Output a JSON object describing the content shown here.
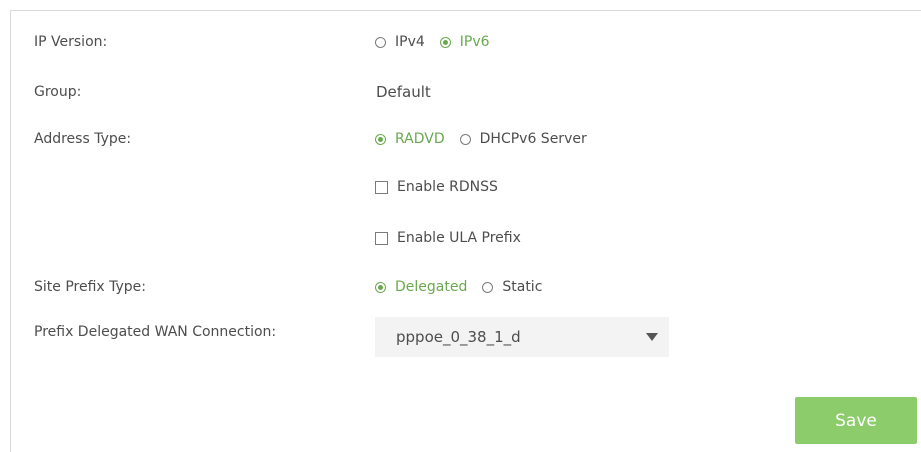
{
  "form": {
    "ip_version": {
      "label": "IP Version:",
      "options": [
        {
          "label": "IPv4",
          "selected": false
        },
        {
          "label": "IPv6",
          "selected": true
        }
      ]
    },
    "group": {
      "label": "Group:",
      "value": "Default"
    },
    "address_type": {
      "label": "Address Type:",
      "options": [
        {
          "label": "RADVD",
          "selected": true
        },
        {
          "label": "DHCPv6 Server",
          "selected": false
        }
      ]
    },
    "enable_rdnss": {
      "label": "Enable RDNSS",
      "checked": false
    },
    "enable_ula_prefix": {
      "label": "Enable ULA Prefix",
      "checked": false
    },
    "site_prefix_type": {
      "label": "Site Prefix Type:",
      "options": [
        {
          "label": "Delegated",
          "selected": true
        },
        {
          "label": "Static",
          "selected": false
        }
      ]
    },
    "prefix_delegated_wan": {
      "label": "Prefix Delegated WAN Connection:",
      "value": "pppoe_0_38_1_d"
    }
  },
  "actions": {
    "save_label": "Save"
  },
  "colors": {
    "accent": "#6aa84f",
    "save_button": "#8ccc6a"
  }
}
